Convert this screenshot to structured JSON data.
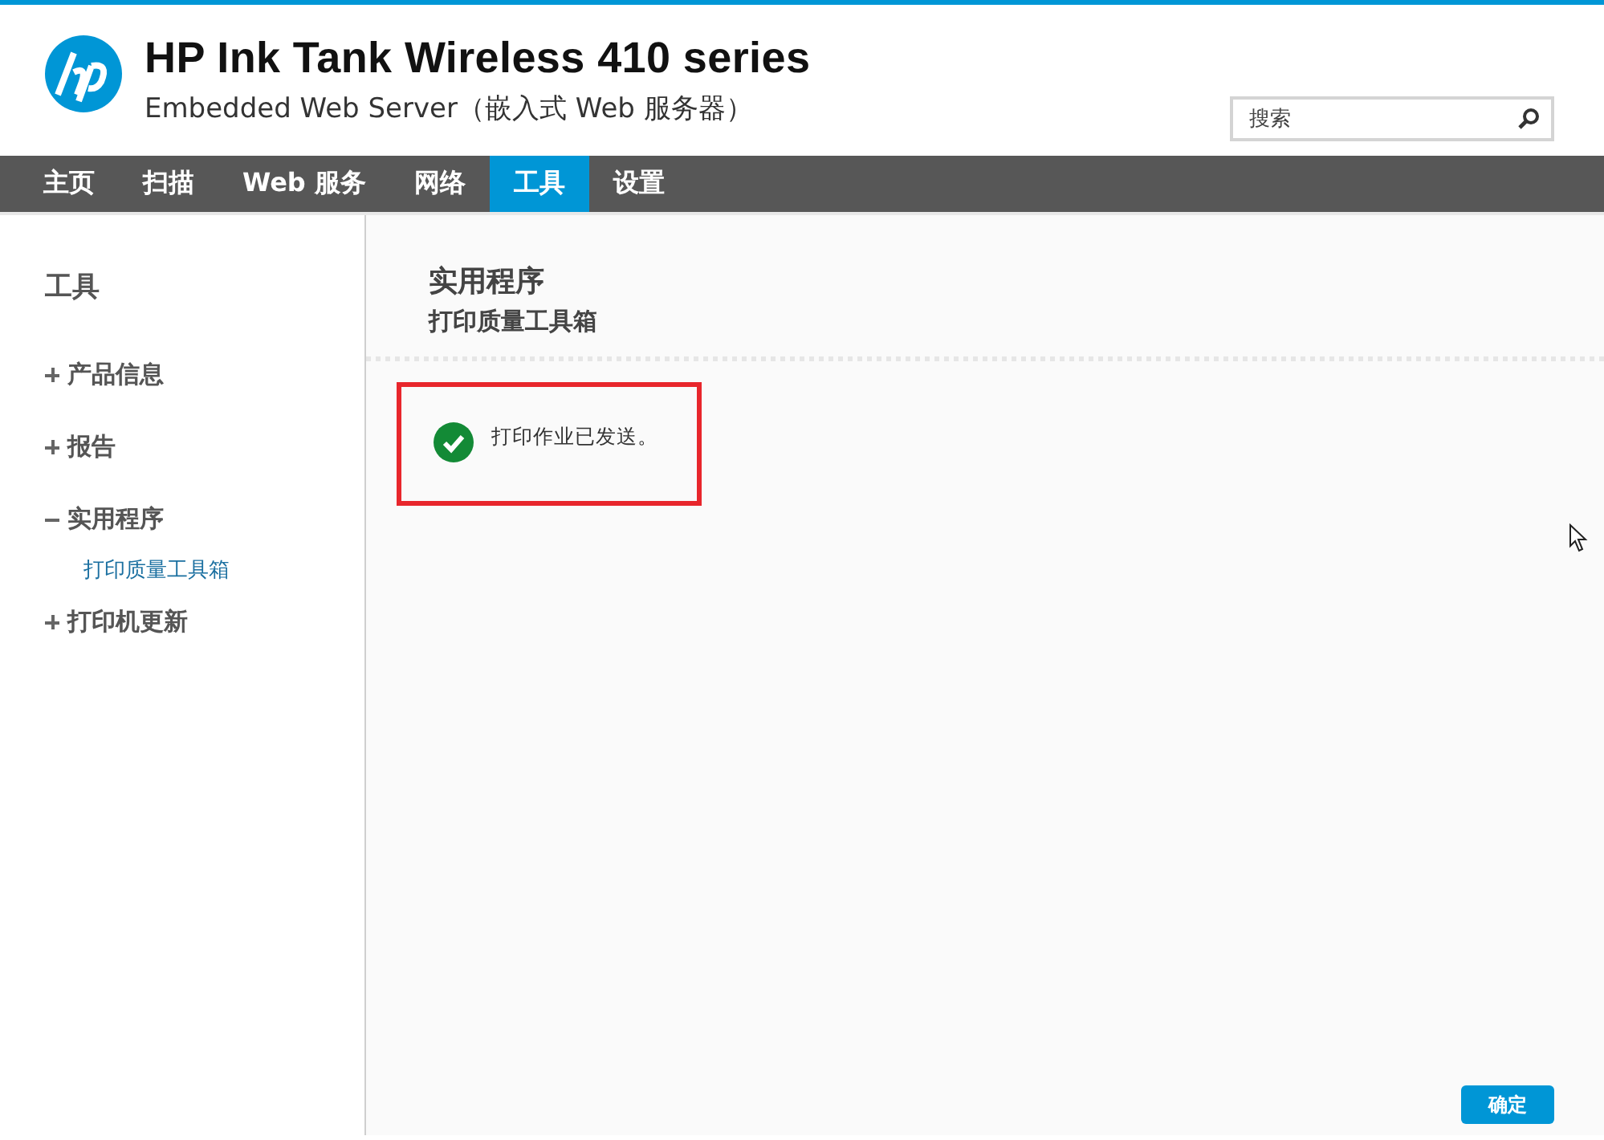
{
  "header": {
    "title": "HP Ink Tank Wireless 410 series",
    "subtitle": "Embedded Web Server（嵌入式 Web 服务器）"
  },
  "search": {
    "placeholder": "搜索"
  },
  "tabs": [
    {
      "label": "主页",
      "selected": false
    },
    {
      "label": "扫描",
      "selected": false
    },
    {
      "label": "Web 服务",
      "selected": false
    },
    {
      "label": "网络",
      "selected": false
    },
    {
      "label": "工具",
      "selected": true
    },
    {
      "label": "设置",
      "selected": false
    }
  ],
  "sidebar": {
    "title": "工具",
    "items": [
      {
        "label": "产品信息",
        "expanded": false
      },
      {
        "label": "报告",
        "expanded": false
      },
      {
        "label": "实用程序",
        "expanded": true,
        "children": [
          {
            "label": "打印质量工具箱",
            "selected": true
          }
        ]
      },
      {
        "label": "打印机更新",
        "expanded": false
      }
    ]
  },
  "content": {
    "title": "实用程序",
    "subtitle": "打印质量工具箱",
    "message": {
      "kind": "success",
      "text": "打印作业已发送。"
    },
    "button": "确定"
  }
}
